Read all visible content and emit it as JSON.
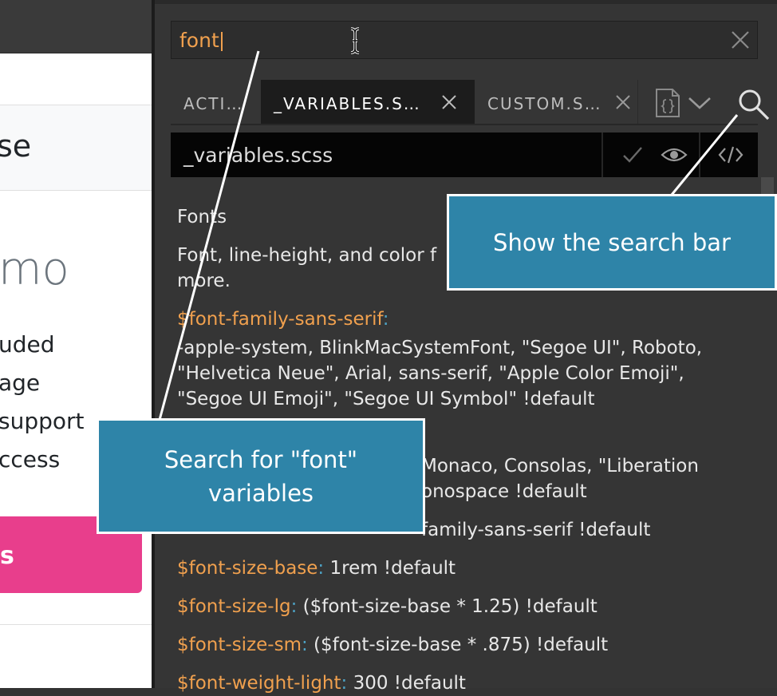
{
  "preview": {
    "nav_text": "se",
    "heading": "mo",
    "lines": [
      "uded",
      "age",
      "support",
      "ccess"
    ],
    "cta_label": "s"
  },
  "search": {
    "value": "font",
    "placeholder": ""
  },
  "tabs": [
    {
      "label": "ACTI…",
      "active": false
    },
    {
      "label": "_VARIABLES.S…",
      "active": true
    },
    {
      "label": "CUSTOM.S…",
      "active": false
    }
  ],
  "file_bar": {
    "filename": "_variables.scss"
  },
  "content": {
    "section_title": "Fonts",
    "description_lines": [
      "Font, line-height, and color f",
      "more."
    ],
    "items": [
      {
        "var": "$font-family-sans-serif",
        "colon": ":",
        "value_lines": [
          "-apple-system, BlinkMacSystemFont, \"Segoe UI\", Roboto,",
          "\"Helvetica Neue\", Arial, sans-serif, \"Apple Color Emoji\",",
          "\"Segoe UI Emoji\", \"Segoe UI Symbol\" !default"
        ]
      },
      {
        "partial_lines": [
          "Monaco, Consolas, \"Liberation",
          "onospace !default"
        ]
      },
      {
        "partial": "family-sans-serif !default"
      },
      {
        "var": "$font-size-base",
        "colon": ":",
        "value": " 1rem !default"
      },
      {
        "var": "$font-size-lg",
        "colon": ":",
        "value": " ($font-size-base * 1.25) !default"
      },
      {
        "var": "$font-size-sm",
        "colon": ":",
        "value": " ($font-size-base * .875) !default"
      },
      {
        "var": "$font-weight-light",
        "colon": ":",
        "value": " 300 !default"
      }
    ]
  },
  "callouts": {
    "search_bar": "Show the search bar",
    "search_font": "Search for \"font\" variables"
  },
  "colors": {
    "accent_orange": "#f0a04e",
    "callout_blue": "#2e84a8",
    "cta_pink": "#e83e8c"
  }
}
